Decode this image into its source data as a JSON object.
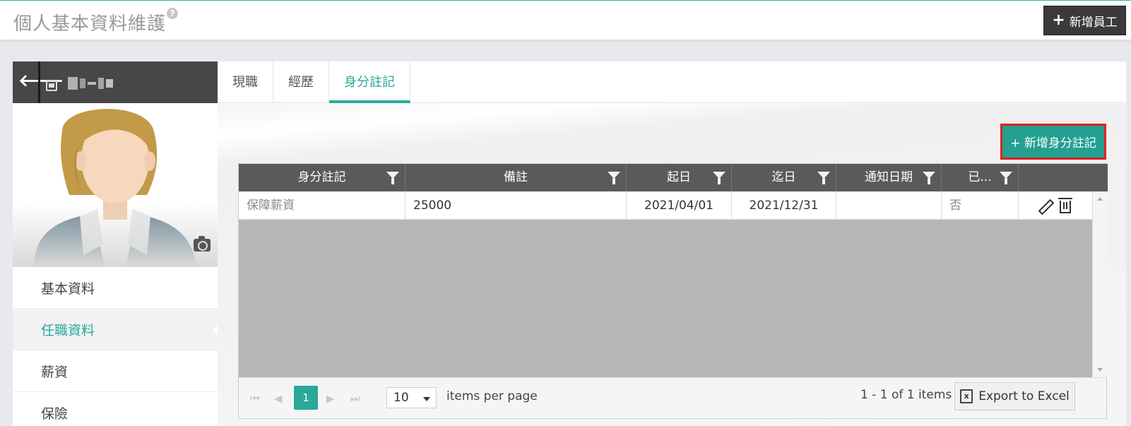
{
  "header": {
    "title": "個人基本資料維護",
    "help_glyph": "?",
    "new_employee_plus": "+",
    "new_employee_label": "新增員工"
  },
  "employee": {
    "back_glyph": "🡐"
  },
  "side_menu": {
    "items": [
      {
        "label": "基本資料"
      },
      {
        "label": "任職資料"
      },
      {
        "label": "薪資"
      },
      {
        "label": "保險"
      }
    ]
  },
  "tabs": [
    {
      "label": "現職"
    },
    {
      "label": "經歷"
    },
    {
      "label": "身分註記"
    }
  ],
  "actions": {
    "add_identity_label": "+ 新增身分註記"
  },
  "grid": {
    "columns": [
      {
        "label": "身分註記"
      },
      {
        "label": "備註"
      },
      {
        "label": "起日"
      },
      {
        "label": "迄日"
      },
      {
        "label": "通知日期"
      },
      {
        "label": "已..."
      },
      {
        "label": ""
      }
    ],
    "rows": [
      {
        "identity": "保障薪資",
        "note": "25000",
        "start": "2021/04/01",
        "end": "2021/12/31",
        "notify_date": "",
        "done": "否"
      }
    ]
  },
  "pager": {
    "first_glyph": "⏮",
    "prev_glyph": "◀",
    "next_glyph": "▶",
    "last_glyph": "⏭",
    "current_page": "1",
    "page_size": "10",
    "items_per_page_label": "items per page",
    "info": "1 - 1 of 1 items",
    "export_label": "Export to Excel",
    "export_icon_letter": "x"
  },
  "colors": {
    "accent": "#2aa89a",
    "header_dark": "#474747",
    "grid_header": "#5a5a5a",
    "highlight_border": "#e02020"
  }
}
